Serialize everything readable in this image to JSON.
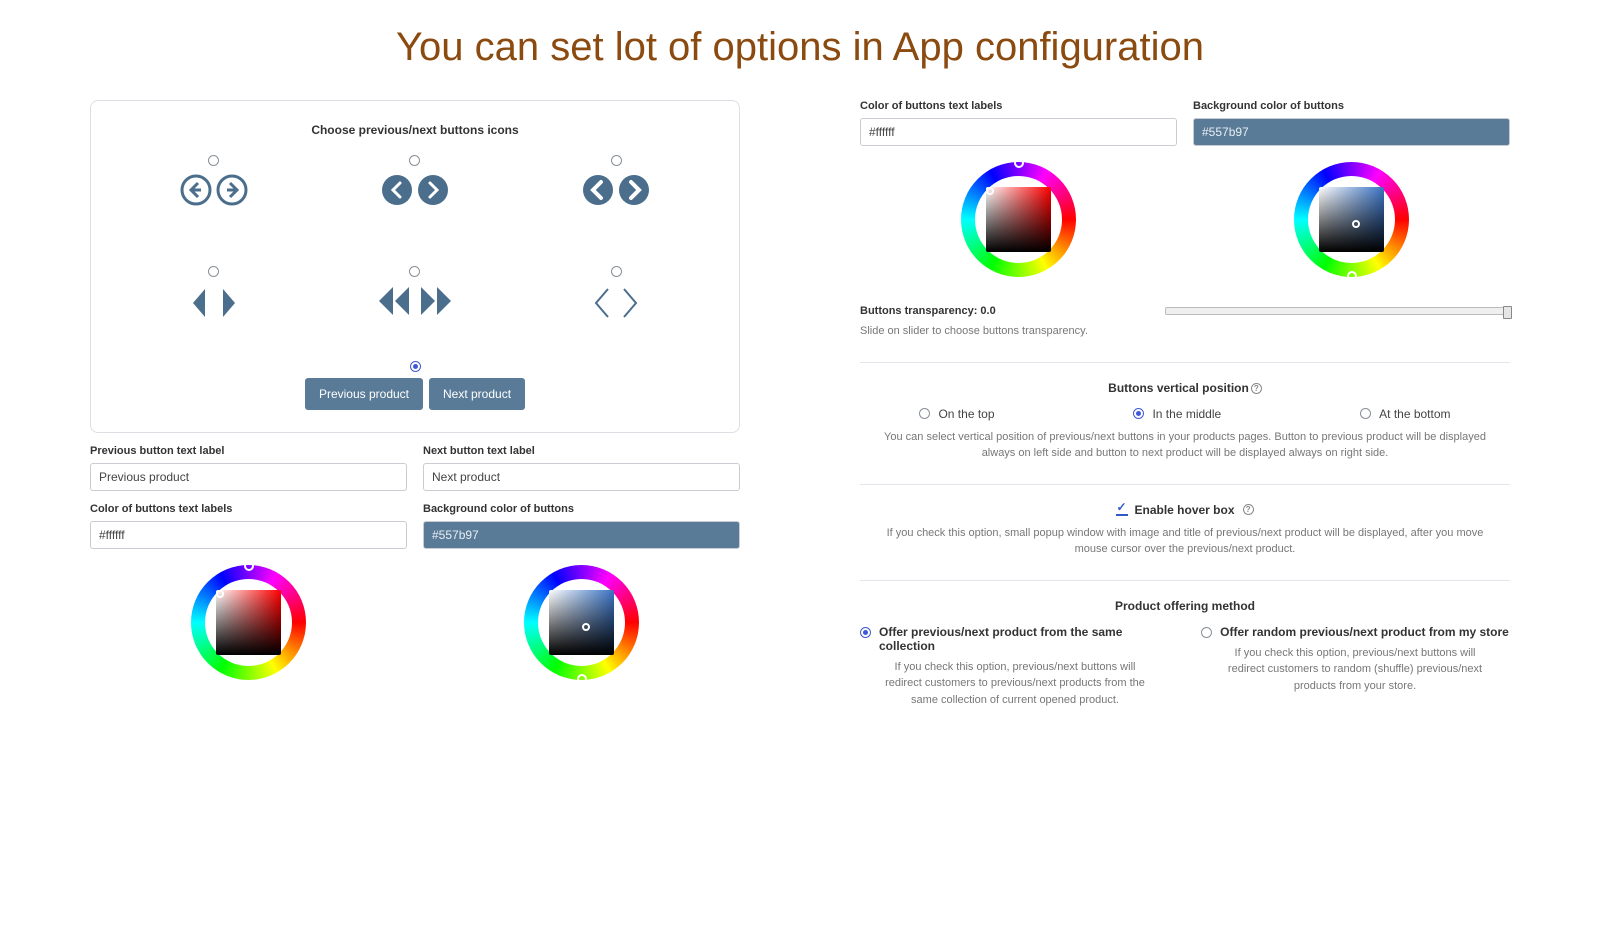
{
  "page_title": "You can set lot of options in App configuration",
  "left": {
    "panel_title": "Choose previous/next buttons icons",
    "text_buttons": {
      "prev": "Previous product",
      "next": "Next product"
    },
    "selected_icon_index": 6,
    "prev_label_field": {
      "label": "Previous button text label",
      "value": "Previous product"
    },
    "next_label_field": {
      "label": "Next button text label",
      "value": "Next product"
    },
    "text_color": {
      "label": "Color of buttons text labels",
      "value": "#ffffff"
    },
    "bg_color": {
      "label": "Background color of buttons",
      "value": "#557b97"
    }
  },
  "right": {
    "text_color": {
      "label": "Color of buttons text labels",
      "value": "#ffffff"
    },
    "bg_color": {
      "label": "Background color of buttons",
      "value": "#557b97"
    },
    "transparency": {
      "label": "Buttons transparency: 0.0",
      "help": "Slide on slider to choose buttons transparency."
    },
    "vpos": {
      "title": "Buttons vertical position",
      "options": {
        "top": "On the top",
        "middle": "In the middle",
        "bottom": "At the bottom"
      },
      "help": "You can select vertical position of previous/next buttons in your products pages. Button to previous product will be displayed always on left side and button to next product will be displayed always on right side."
    },
    "hover": {
      "label": "Enable hover box",
      "help": "If you check this option, small popup window with image and title of previous/next product will be displayed, after you move mouse cursor over the previous/next product."
    },
    "offering": {
      "title": "Product offering method",
      "opt1": {
        "label": "Offer previous/next product from the same collection",
        "help": "If you check this option, previous/next buttons will redirect customers to previous/next products from the same collection of current opened product."
      },
      "opt2": {
        "label": "Offer random previous/next product from my store",
        "help": "If you check this option, previous/next buttons will redirect customers to random (shuffle) previous/next products from your store."
      }
    }
  }
}
